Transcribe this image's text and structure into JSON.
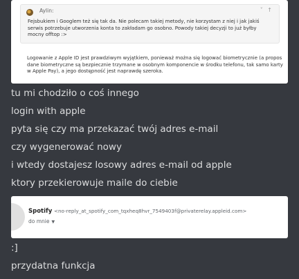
{
  "quote": {
    "author": "Aylin:",
    "controls": "˅ ↑",
    "text": "Fejsbukiem i Googlem też się tak da. Nie polecam takiej metody, nie korzystam z niej i jak jakiś serwis potrzebuje utworzenia konta to zakładam go osobno. Powody takiej decyzji to już byłby mocny offtop :>"
  },
  "reply_text": "Logowanie z Apple ID jest prawdziwym wyjątkiem, ponieważ można się logować biometrycznie (a propos dane biometryczne są bezpiecznie trzymane w osobnym komponencie w środku telefonu, tak samo karty w Apple Pay), a jego dostępność jest naprawdę szeroka.",
  "messages": [
    "tu mi chodziło o coś innego",
    "login with apple",
    "pyta się czy ma przekazać twój adres e-mail",
    "czy wygenerować nowy",
    "i wtedy dostajesz losowy adres e-mail od apple",
    "ktory przekierowuje maile do ciebie",
    ":]",
    "przydatna funkcja"
  ],
  "email": {
    "sender_name": "Spotify",
    "sender_address": "<no-reply_at_spotify_com_tqxheq8hvr_7549403f@privaterelay.appleid.com>",
    "recipient": "do mnie"
  }
}
